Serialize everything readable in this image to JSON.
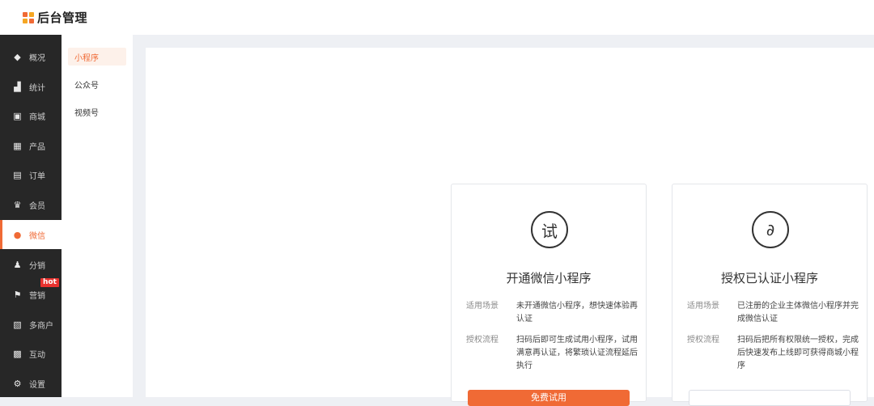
{
  "app": {
    "title": "后台管理"
  },
  "sidebar": {
    "items": [
      {
        "label": "概况",
        "icon": "layers-icon"
      },
      {
        "label": "统计",
        "icon": "chart-icon"
      },
      {
        "label": "商城",
        "icon": "store-icon"
      },
      {
        "label": "产品",
        "icon": "grid-icon"
      },
      {
        "label": "订单",
        "icon": "clipboard-icon"
      },
      {
        "label": "会员",
        "icon": "crown-icon"
      },
      {
        "label": "微信",
        "icon": "wechat-icon"
      },
      {
        "label": "分销",
        "icon": "users-icon"
      },
      {
        "label": "营销",
        "icon": "flag-icon",
        "badge": "hot"
      },
      {
        "label": "多商户",
        "icon": "shop-icon"
      },
      {
        "label": "互动",
        "icon": "apps-icon"
      },
      {
        "label": "设置",
        "icon": "gear-icon"
      }
    ],
    "active": "微信"
  },
  "subnav": {
    "items": [
      {
        "label": "小程序"
      },
      {
        "label": "公众号"
      },
      {
        "label": "视频号"
      }
    ],
    "active": "小程序"
  },
  "cards": [
    {
      "icon_text": "试",
      "title": "开通微信小程序",
      "scene_label": "适用场景",
      "scene_text": "未开通微信小程序，想快速体验再认证",
      "flow_label": "授权流程",
      "flow_text": "扫码后即可生成试用小程序，试用满意再认证，将繁琐认证流程延后执行",
      "button": "免费试用"
    },
    {
      "icon_text": "∂",
      "title": "授权已认证小程序",
      "scene_label": "适用场景",
      "scene_text": "已注册的企业主体微信小程序并完成微信认证",
      "flow_label": "授权流程",
      "flow_text": "扫码后把所有权限统一授权，完成后快速发布上线即可获得商城小程序",
      "button": ""
    }
  ],
  "colors": {
    "accent": "#f06a35",
    "sidebar_bg": "#272727",
    "hot": "#e8322f"
  }
}
